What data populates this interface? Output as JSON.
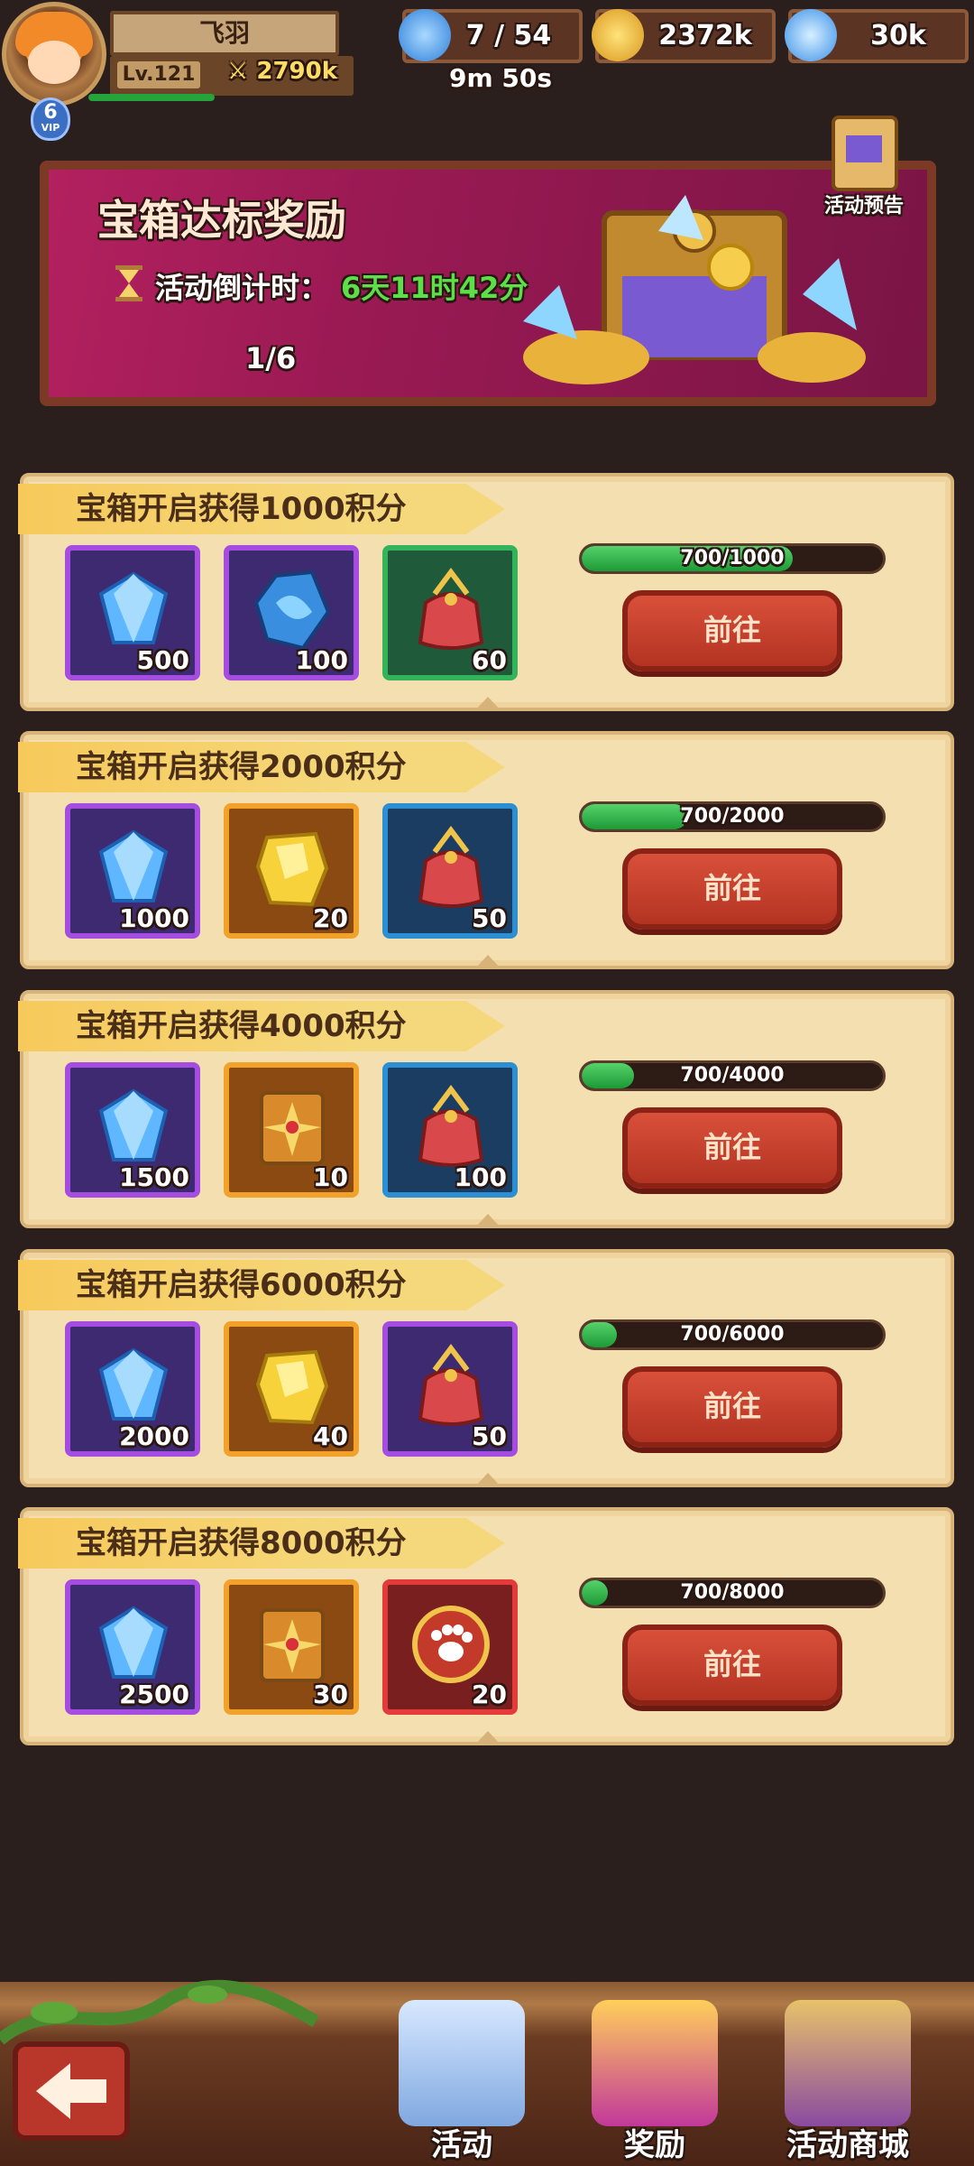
{
  "player": {
    "name": "飞羽",
    "level": "Lv.121",
    "power": "2790k",
    "vip": "6",
    "vip_label": "VIP"
  },
  "resources": {
    "stamina": "7 / 54",
    "stamina_timer": "9m 50s",
    "gold": "2372k",
    "gems": "30k"
  },
  "banner": {
    "title": "宝箱达标奖励",
    "countdown_label": "活动倒计时：",
    "countdown_value": "6天11时42分",
    "page": "1/6",
    "preview_label": "活动预告"
  },
  "tiers": [
    {
      "title": "宝箱开启获得1000积分",
      "progress_text": "700/1000",
      "progress": 0.7,
      "button": "前往",
      "items": [
        {
          "icon": "blue-gem-icon",
          "qty": "500",
          "rarity": "purple"
        },
        {
          "icon": "blue-crystal-icon",
          "qty": "100",
          "rarity": "purple"
        },
        {
          "icon": "red-pouch-icon",
          "qty": "60",
          "rarity": "green"
        }
      ]
    },
    {
      "title": "宝箱开启获得2000积分",
      "progress_text": "700/2000",
      "progress": 0.35,
      "button": "前往",
      "items": [
        {
          "icon": "blue-gem-icon",
          "qty": "1000",
          "rarity": "purple"
        },
        {
          "icon": "gold-ore-icon",
          "qty": "20",
          "rarity": "orange"
        },
        {
          "icon": "red-pouch-icon",
          "qty": "50",
          "rarity": "blue"
        }
      ]
    },
    {
      "title": "宝箱开启获得4000积分",
      "progress_text": "700/4000",
      "progress": 0.175,
      "button": "前往",
      "items": [
        {
          "icon": "blue-gem-icon",
          "qty": "1500",
          "rarity": "purple"
        },
        {
          "icon": "golden-book-icon",
          "qty": "10",
          "rarity": "orange"
        },
        {
          "icon": "red-pouch-icon",
          "qty": "100",
          "rarity": "blue"
        }
      ]
    },
    {
      "title": "宝箱开启获得6000积分",
      "progress_text": "700/6000",
      "progress": 0.117,
      "button": "前往",
      "items": [
        {
          "icon": "blue-gem-icon",
          "qty": "2000",
          "rarity": "purple"
        },
        {
          "icon": "gold-ore-icon",
          "qty": "40",
          "rarity": "orange"
        },
        {
          "icon": "red-pouch-icon",
          "qty": "50",
          "rarity": "purple"
        }
      ]
    },
    {
      "title": "宝箱开启获得8000积分",
      "progress_text": "700/8000",
      "progress": 0.0875,
      "button": "前往",
      "items": [
        {
          "icon": "blue-gem-icon",
          "qty": "2500",
          "rarity": "purple"
        },
        {
          "icon": "golden-book-icon",
          "qty": "30",
          "rarity": "orange"
        },
        {
          "icon": "paw-orb-icon",
          "qty": "20",
          "rarity": "red"
        }
      ]
    }
  ],
  "bottom_nav": [
    {
      "label": "活动",
      "icon": "gift-box-icon"
    },
    {
      "label": "奖励",
      "icon": "reward-gifts-icon"
    },
    {
      "label": "活动商城",
      "icon": "treasure-chest-icon"
    }
  ],
  "colors": {
    "accent_green": "#5ce04a",
    "button_red": "#c43f2c",
    "card_bg": "#f4dfb0",
    "banner": "#9b1a54"
  }
}
